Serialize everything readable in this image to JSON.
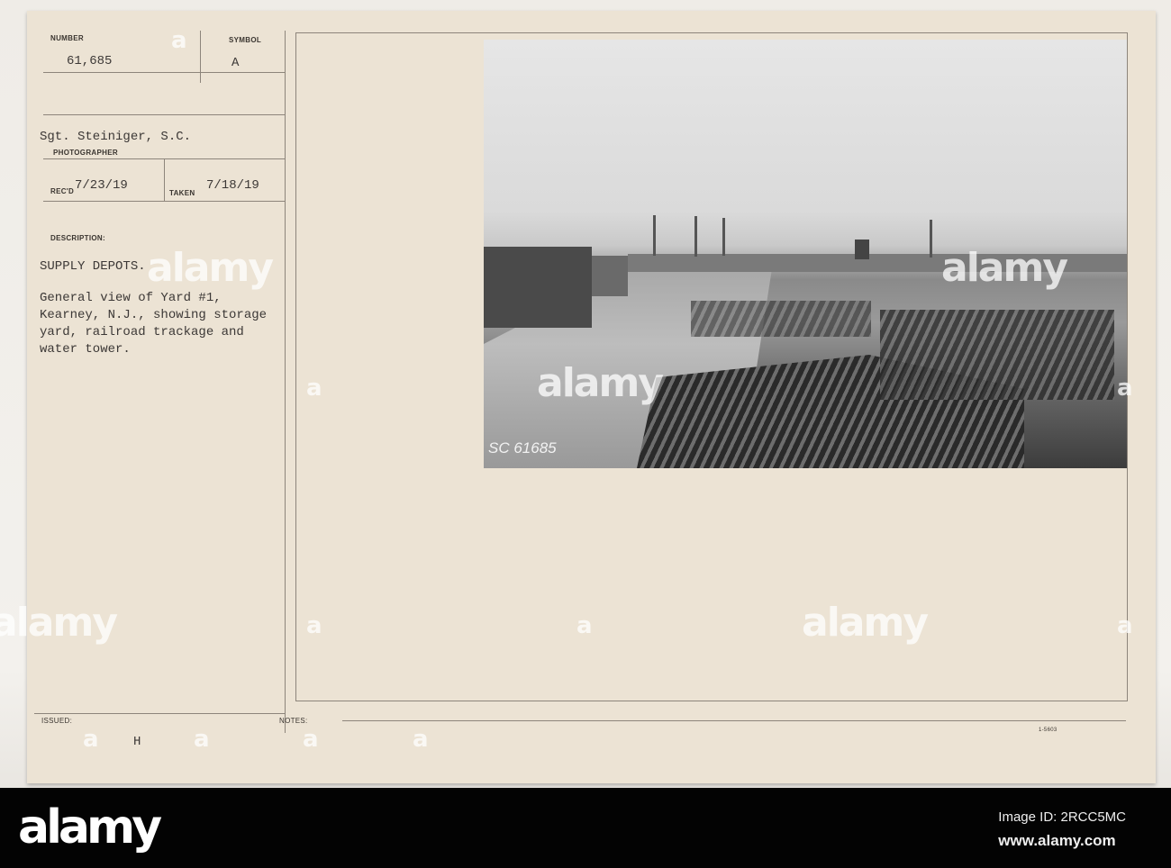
{
  "card": {
    "number_label": "NUMBER",
    "number": "61,685",
    "symbol_label": "SYMBOL",
    "symbol": "A",
    "photographer": "Sgt. Steiniger, S.C.",
    "photographer_label": "PHOTOGRAPHER",
    "recd_label": "REC'D",
    "recd": "7/23/19",
    "taken_label": "TAKEN",
    "taken": "7/18/19",
    "description_label": "DESCRIPTION:",
    "description_title": "SUPPLY DEPOTS.",
    "description_lines": [
      "General view of Yard #1,",
      "Kearney, N.J., showing storage",
      "yard, railroad trackage and",
      "water tower."
    ],
    "issued_label": "ISSUED:",
    "issued": "H",
    "notes_label": "NOTES:",
    "form_number": "1-5603"
  },
  "photo": {
    "negative_number": "SC 61685"
  },
  "watermark": {
    "text": "alamy",
    "short": "a"
  },
  "footer": {
    "logo": "alamy",
    "image_id": "Image ID: 2RCC5MC",
    "url": "www.alamy.com"
  }
}
